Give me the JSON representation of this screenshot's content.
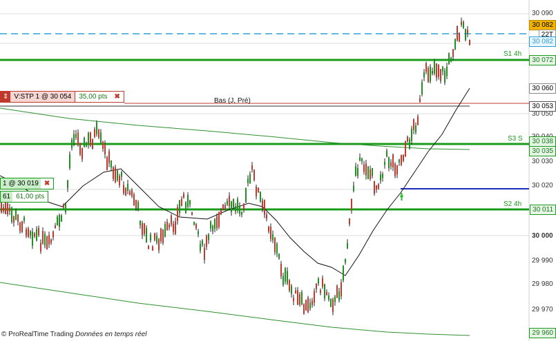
{
  "axis_labels": [
    "30 090",
    "30 050",
    "30 040",
    "30 030",
    "30 020",
    "30 000",
    "29 990",
    "29 980",
    "29 970"
  ],
  "price_tags": {
    "current": "30 082",
    "current_time": "22T",
    "s1_value": "30 072",
    "red_line": "30 060",
    "bas_value": "30 053",
    "s3_value": "30 038",
    "level_value": "30 035",
    "stop_value": "30 020",
    "s2_value": "30 011",
    "bottom_value": "29 960",
    "current_under": "30 082"
  },
  "levels": {
    "s1": "S1 4h",
    "s3": "S3 S",
    "s2": "S2 4h",
    "bas": "Bas (J, Pré)"
  },
  "orders": {
    "stop": {
      "label": "V:STP  1 @ 30 054",
      "pts": "35,00 pts"
    },
    "limit": {
      "label": "1 @ 30 019",
      "qty": "61",
      "pts": "61,00 pts"
    }
  },
  "footer": {
    "brand": "© ProRealTime Trading",
    "realtime": "Données en temps réel"
  },
  "colors": {
    "support_green": "#1a9a1a",
    "dash_blue": "#2aa0d8",
    "candle_green": "#1f8f1f",
    "candle_red": "#c0392b",
    "current_tag": "#f2b200"
  }
}
